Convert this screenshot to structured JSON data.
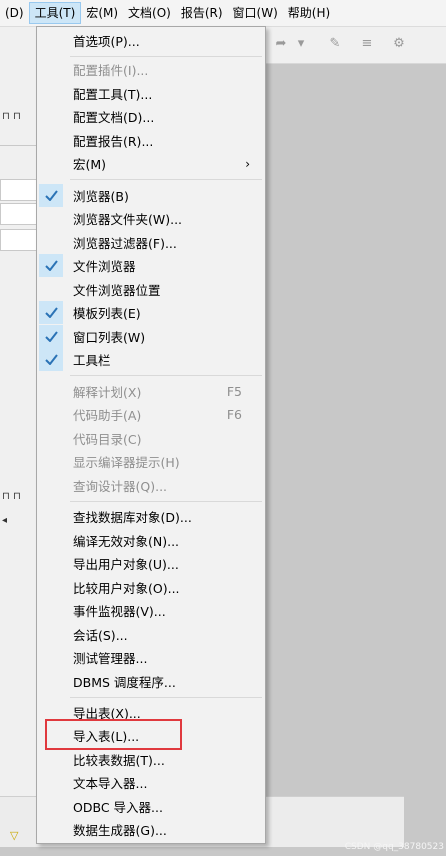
{
  "menubar": {
    "items": [
      {
        "label": "(D)"
      },
      {
        "label": "工具(T)"
      },
      {
        "label": "宏(M)"
      },
      {
        "label": "文档(O)"
      },
      {
        "label": "报告(R)"
      },
      {
        "label": "窗口(W)"
      },
      {
        "label": "帮助(H)"
      }
    ]
  },
  "menu": {
    "items": [
      {
        "label": "首选项(P)..."
      },
      {
        "label": "配置插件(I)..."
      },
      {
        "label": "配置工具(T)..."
      },
      {
        "label": "配置文档(D)..."
      },
      {
        "label": "配置报告(R)..."
      },
      {
        "label": "宏(M)"
      },
      {
        "label": "浏览器(B)"
      },
      {
        "label": "浏览器文件夹(W)..."
      },
      {
        "label": "浏览器过滤器(F)..."
      },
      {
        "label": "文件浏览器"
      },
      {
        "label": "文件浏览器位置"
      },
      {
        "label": "模板列表(E)"
      },
      {
        "label": "窗口列表(W)"
      },
      {
        "label": "工具栏"
      },
      {
        "label": "解释计划(X)",
        "shortcut": "F5"
      },
      {
        "label": "代码助手(A)",
        "shortcut": "F6"
      },
      {
        "label": "代码目录(C)"
      },
      {
        "label": "显示编译器提示(H)"
      },
      {
        "label": "查询设计器(Q)..."
      },
      {
        "label": "查找数据库对象(D)..."
      },
      {
        "label": "编译无效对象(N)..."
      },
      {
        "label": "导出用户对象(U)..."
      },
      {
        "label": "比较用户对象(O)..."
      },
      {
        "label": "事件监视器(V)..."
      },
      {
        "label": "会话(S)..."
      },
      {
        "label": "测试管理器..."
      },
      {
        "label": "DBMS 调度程序..."
      },
      {
        "label": "导出表(X)..."
      },
      {
        "label": "导入表(L)..."
      },
      {
        "label": "比较表数据(T)..."
      },
      {
        "label": "文本导入器..."
      },
      {
        "label": "ODBC 导入器..."
      },
      {
        "label": "数据生成器(G)..."
      }
    ],
    "submenu_arrow": "›",
    "highlight_color": "#e0393e"
  },
  "watermark": "CSDN @qq_38780523"
}
